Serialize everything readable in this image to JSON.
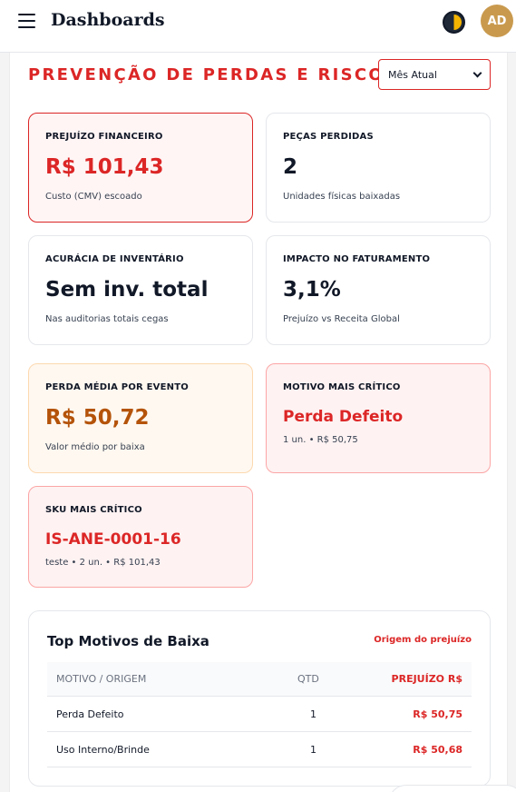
{
  "header": {
    "title": "Dashboards",
    "avatar_initials": "AD",
    "menu_icon": "hamburger-menu-icon",
    "theme_icon": "theme-toggle-icon"
  },
  "page": {
    "title": "PREVENÇÃO DE PERDAS E RISCO",
    "period_select": {
      "selected": "Mês Atual"
    }
  },
  "cards": [
    {
      "label": "PREJUÍZO FINANCEIRO",
      "value": "R$ 101,43",
      "sub": "Custo (CMV) escoado",
      "accent": "#dc2626"
    },
    {
      "label": "PEÇAS PERDIDAS",
      "value": "2",
      "sub": "Unidades físicas baixadas"
    },
    {
      "label": "ACURÁCIA DE INVENTÁRIO",
      "value": "Sem inv. total",
      "sub": "Nas auditorias totais cegas"
    },
    {
      "label": "IMPACTO NO FATURAMENTO",
      "value": "3,1%",
      "sub": "Prejuízo vs Receita Global"
    },
    {
      "label": "PERDA MÉDIA POR EVENTO",
      "value": "R$ 50,72",
      "sub": "Valor médio por baixa",
      "accent": "#b45309"
    },
    {
      "label": "MOTIVO MAIS CRÍTICO",
      "value": "Perda Defeito",
      "sub": "1 un. • R$ 50,75",
      "accent": "#dc2626"
    },
    {
      "label": "SKU MAIS CRÍTICO",
      "value": "IS-ANE-0001-16",
      "sub": "teste • 2 un. • R$ 101,43",
      "accent": "#dc2626"
    }
  ],
  "table": {
    "title": "Top Motivos de Baixa",
    "link": "Origem do prejuízo",
    "columns": [
      "MOTIVO / ORIGEM",
      "QTD",
      "PREJUÍZO R$"
    ],
    "rows": [
      [
        "Perda Defeito",
        "1",
        "R$ 50,75"
      ],
      [
        "Uso Interno/Brinde",
        "1",
        "R$ 50,68"
      ]
    ]
  },
  "colors": {
    "accent_red": "#dc2626",
    "accent_orange": "#b45309",
    "avatar_bg": "#c99a4e"
  }
}
